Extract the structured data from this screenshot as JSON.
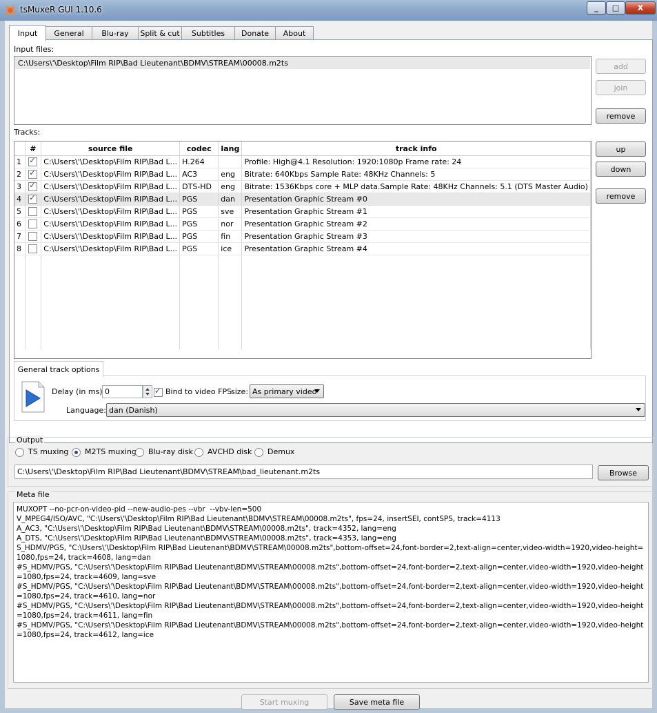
{
  "window": {
    "title": "tsMuxeR GUI 1.10.6",
    "minimize": "_",
    "maximize": "□",
    "close": "X"
  },
  "tabs": [
    "Input",
    "General",
    "Blu-ray",
    "Split & cut",
    "Subtitles",
    "Donate",
    "About"
  ],
  "input": {
    "input_files_label": "Input files:",
    "files": [
      "C:\\Users\\'\\Desktop\\Film RIP\\Bad Lieutenant\\BDMV\\STREAM\\00008.m2ts"
    ],
    "add_label": "add",
    "join_label": "join",
    "remove_label": "remove",
    "tracks_label": "Tracks:",
    "up_label": "up",
    "down_label": "down",
    "remove_track_label": "remove"
  },
  "tracks": {
    "headers": [
      "#",
      "source file",
      "codec",
      "lang",
      "track info"
    ],
    "rows": [
      {
        "n": "1",
        "checked": true,
        "source": "C:\\Users\\'\\Desktop\\Film RIP\\Bad L...",
        "codec": "H.264",
        "lang": "",
        "info": "Profile: High@4.1  Resolution: 1920:1080p  Frame rate: 24"
      },
      {
        "n": "2",
        "checked": true,
        "source": "C:\\Users\\'\\Desktop\\Film RIP\\Bad L...",
        "codec": "AC3",
        "lang": "eng",
        "info": "Bitrate: 640Kbps Sample Rate: 48KHz Channels: 5"
      },
      {
        "n": "3",
        "checked": true,
        "source": "C:\\Users\\'\\Desktop\\Film RIP\\Bad L...",
        "codec": "DTS-HD",
        "lang": "eng",
        "info": "Bitrate: 1536Kbps  core + MLP data.Sample Rate: 48KHz  Channels: 5.1 (DTS Master Audio)"
      },
      {
        "n": "4",
        "checked": true,
        "source": "C:\\Users\\'\\Desktop\\Film RIP\\Bad L...",
        "codec": "PGS",
        "lang": "dan",
        "info": "Presentation Graphic Stream #0"
      },
      {
        "n": "5",
        "checked": false,
        "source": "C:\\Users\\'\\Desktop\\Film RIP\\Bad L...",
        "codec": "PGS",
        "lang": "sve",
        "info": "Presentation Graphic Stream #1"
      },
      {
        "n": "6",
        "checked": false,
        "source": "C:\\Users\\'\\Desktop\\Film RIP\\Bad L...",
        "codec": "PGS",
        "lang": "nor",
        "info": "Presentation Graphic Stream #2"
      },
      {
        "n": "7",
        "checked": false,
        "source": "C:\\Users\\'\\Desktop\\Film RIP\\Bad L...",
        "codec": "PGS",
        "lang": "fin",
        "info": "Presentation Graphic Stream #3"
      },
      {
        "n": "8",
        "checked": false,
        "source": "C:\\Users\\'\\Desktop\\Film RIP\\Bad L...",
        "codec": "PGS",
        "lang": "ice",
        "info": "Presentation Graphic Stream #4"
      }
    ],
    "selected_row": 4
  },
  "track_options": {
    "tab_label": "General track options",
    "delay_label": "Delay (in ms):",
    "delay_value": "0",
    "bind_fps_label": "Bind to video FPS",
    "bind_fps_checked": true,
    "size_label": "size:",
    "size_value": "As primary video",
    "language_label": "Language:",
    "language_value": "dan (Danish)"
  },
  "output": {
    "group_label": "Output",
    "modes": [
      "TS muxing",
      "M2TS muxing",
      "Blu-ray disk",
      "AVCHD disk",
      "Demux"
    ],
    "selected_mode": 1,
    "path": "C:\\Users\\'\\Desktop\\Film RIP\\Bad Lieutenant\\BDMV\\STREAM\\bad_lieutenant.m2ts",
    "browse_label": "Browse"
  },
  "meta": {
    "group_label": "Meta file",
    "text": "MUXOPT --no-pcr-on-video-pid --new-audio-pes --vbr  --vbv-len=500\nV_MPEG4/ISO/AVC, \"C:\\Users\\'\\Desktop\\Film RIP\\Bad Lieutenant\\BDMV\\STREAM\\00008.m2ts\", fps=24, insertSEI, contSPS, track=4113\nA_AC3, \"C:\\Users\\'\\Desktop\\Film RIP\\Bad Lieutenant\\BDMV\\STREAM\\00008.m2ts\", track=4352, lang=eng\nA_DTS, \"C:\\Users\\'\\Desktop\\Film RIP\\Bad Lieutenant\\BDMV\\STREAM\\00008.m2ts\", track=4353, lang=eng\nS_HDMV/PGS, \"C:\\Users\\'\\Desktop\\Film RIP\\Bad Lieutenant\\BDMV\\STREAM\\00008.m2ts\",bottom-offset=24,font-border=2,text-align=center,video-width=1920,video-height=1080,fps=24, track=4608, lang=dan\n#S_HDMV/PGS, \"C:\\Users\\'\\Desktop\\Film RIP\\Bad Lieutenant\\BDMV\\STREAM\\00008.m2ts\",bottom-offset=24,font-border=2,text-align=center,video-width=1920,video-height=1080,fps=24, track=4609, lang=sve\n#S_HDMV/PGS, \"C:\\Users\\'\\Desktop\\Film RIP\\Bad Lieutenant\\BDMV\\STREAM\\00008.m2ts\",bottom-offset=24,font-border=2,text-align=center,video-width=1920,video-height=1080,fps=24, track=4610, lang=nor\n#S_HDMV/PGS, \"C:\\Users\\'\\Desktop\\Film RIP\\Bad Lieutenant\\BDMV\\STREAM\\00008.m2ts\",bottom-offset=24,font-border=2,text-align=center,video-width=1920,video-height=1080,fps=24, track=4611, lang=fin\n#S_HDMV/PGS, \"C:\\Users\\'\\Desktop\\Film RIP\\Bad Lieutenant\\BDMV\\STREAM\\00008.m2ts\",bottom-offset=24,font-border=2,text-align=center,video-width=1920,video-height=1080,fps=24, track=4612, lang=ice"
  },
  "footer": {
    "start_label": "Start muxing",
    "save_label": "Save meta file"
  }
}
